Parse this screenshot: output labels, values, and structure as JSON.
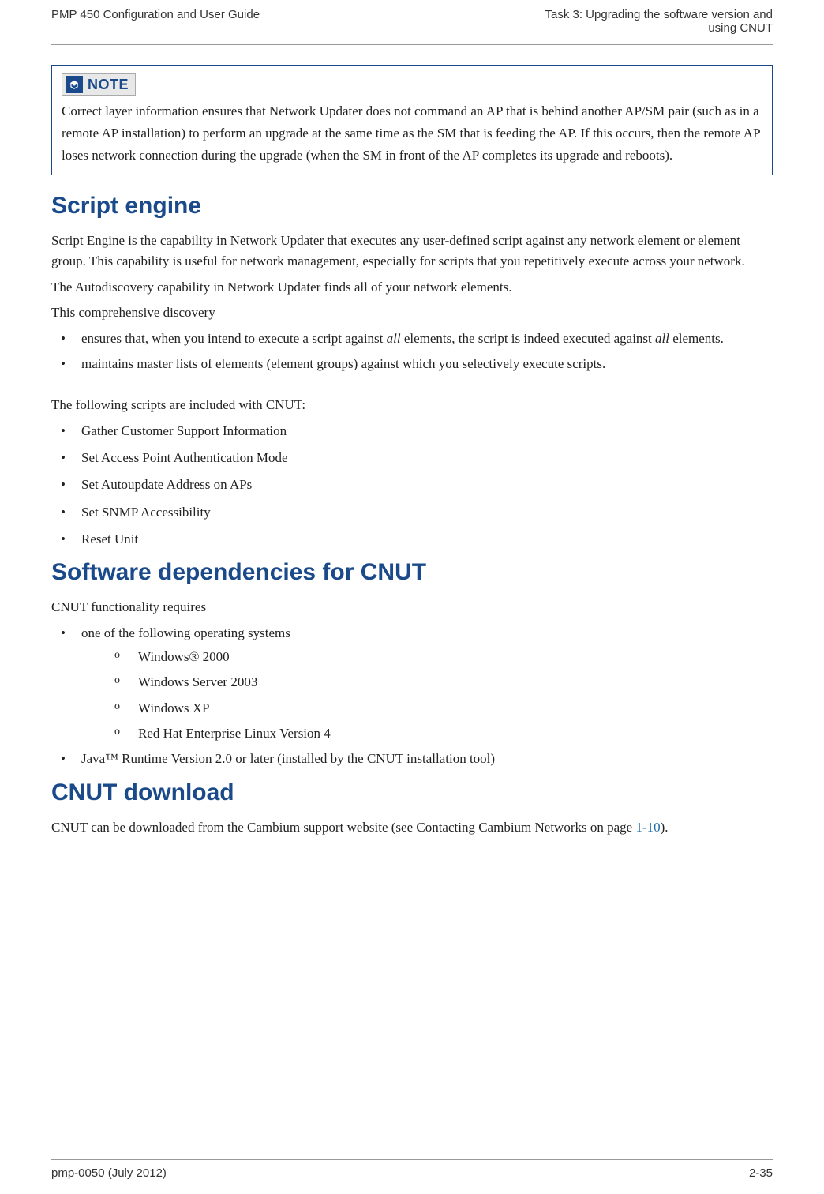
{
  "header": {
    "left": "PMP 450 Configuration and User Guide",
    "rightLine1": "Task 3: Upgrading the software version and",
    "rightLine2": "using CNUT"
  },
  "note": {
    "label": "NOTE",
    "body": "Correct layer information ensures that Network Updater does not command an AP that is behind another AP/SM pair (such as in a remote AP installation) to perform an upgrade at the same time as the SM that is feeding the AP. If this occurs, then the remote AP loses network connection during the upgrade (when the SM in front of the AP completes its upgrade and reboots)."
  },
  "sections": {
    "scriptEngine": {
      "title": "Script engine",
      "p1": "Script Engine is the capability in Network Updater that executes any user-defined script against any network element or element group. This capability is useful for network management, especially for scripts that you repetitively execute across your network.",
      "p2a": "The Autodiscovery capability in Network Updater finds all of your network elements.",
      "p2b": "This comprehensive discovery",
      "b1_prefix": "ensures that, when you intend to execute a script against ",
      "b1_em1": "all",
      "b1_mid": " elements, the script is indeed executed against ",
      "b1_em2": "all",
      "b1_suffix": " elements.",
      "b2": "maintains master lists of elements (element groups) against which you selectively execute scripts.",
      "p3": "The following scripts are included with CNUT:",
      "scripts": [
        "Gather Customer Support Information",
        "Set Access Point Authentication Mode",
        "Set Autoupdate Address on APs",
        "Set SNMP Accessibility",
        "Reset Unit"
      ]
    },
    "deps": {
      "title": "Software dependencies for CNUT",
      "p1": "CNUT functionality requires",
      "b1": "one of the following operating systems",
      "os": [
        "Windows® 2000",
        "Windows Server 2003",
        "Windows XP",
        "Red Hat Enterprise Linux Version 4"
      ],
      "b2": "Java™ Runtime Version 2.0 or later (installed by the CNUT installation tool)"
    },
    "download": {
      "title": "CNUT download",
      "p1_prefix": "CNUT can be downloaded from the Cambium support website (see Contacting Cambium Networks on page ",
      "p1_link": "1-10",
      "p1_suffix": ")."
    }
  },
  "footer": {
    "left": "pmp-0050 (July 2012)",
    "right": "2-35"
  }
}
